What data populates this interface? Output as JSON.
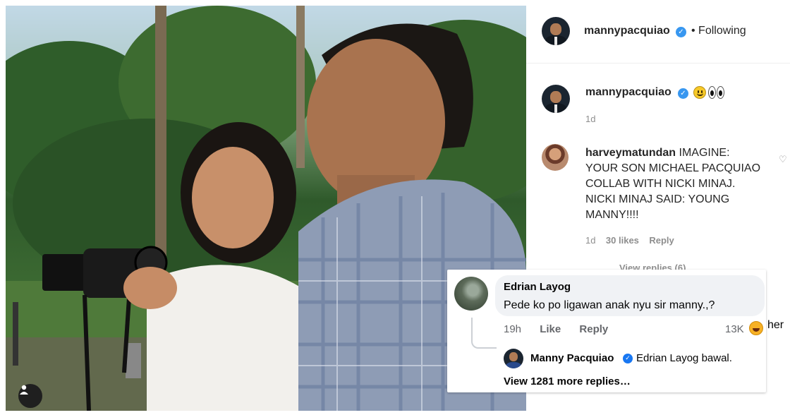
{
  "instagram": {
    "header": {
      "username": "mannypacquiao",
      "follow_status": "• Following"
    },
    "caption": {
      "username": "mannypacquiao",
      "emojis": [
        "grinning-face-emoji",
        "eyes-emoji"
      ],
      "time": "1d"
    },
    "comment": {
      "username": "harveymatundan",
      "text": "IMAGINE: YOUR SON MICHAEL PACQUIAO COLLAB WITH NICKI MINAJ. NICKI MINAJ SAID: YOUNG MANNY!!!!",
      "time": "1d",
      "likes": "30 likes",
      "reply_label": "Reply",
      "view_replies": "View replies (6)"
    },
    "verified_color": "#3897f0"
  },
  "facebook": {
    "comment": {
      "name": "Edrian Layog",
      "text": "Pede ko po ligawan anak nyu sir manny.,?",
      "time": "19h",
      "like_label": "Like",
      "reply_label": "Reply",
      "reaction_count": "13K",
      "reaction_icon": "haha-emoji"
    },
    "reply": {
      "name": "Manny Pacquiao",
      "text": "Edrian Layog bawal."
    },
    "view_more": "View 1281 more replies…",
    "cut_text": "her",
    "verified_color": "#1877f2"
  },
  "photo": {
    "icon": "user-tag-icon"
  }
}
